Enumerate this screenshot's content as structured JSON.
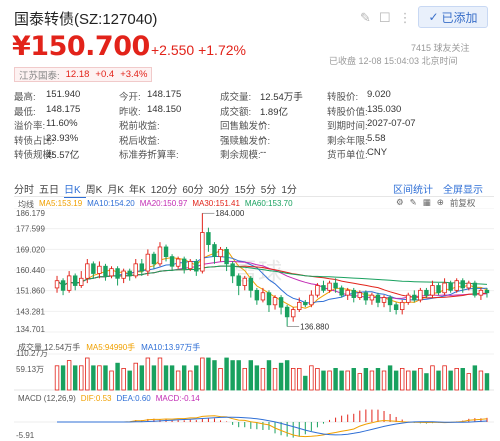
{
  "header": {
    "title": "国泰转债(SZ:127040)",
    "follow_label": "已添加",
    "price": "¥150.700",
    "change": "+2.550 +1.72%",
    "followers": "7415 球友关注",
    "status": "已收盘 12-08 15:04:03 北京时间"
  },
  "stock": {
    "name": "江苏国泰:",
    "price": "12.18",
    "change": "+0.4",
    "pct": "+3.4%"
  },
  "quotes": [
    [
      [
        "最高:",
        "151.940",
        "red"
      ],
      [
        "今开:",
        "148.175",
        "red"
      ],
      [
        "成交量:",
        "12.54万手",
        ""
      ],
      [
        "转股价:",
        "9.020",
        ""
      ]
    ],
    [
      [
        "最低:",
        "148.175",
        "red"
      ],
      [
        "昨收:",
        "148.150",
        ""
      ],
      [
        "成交额:",
        "1.89亿",
        ""
      ],
      [
        "转股价值:",
        "135.030",
        ""
      ]
    ],
    [
      [
        "溢价率:",
        "11.60%",
        ""
      ],
      [
        "税前收益:",
        "--",
        ""
      ],
      [
        "回售触发价:",
        "--",
        ""
      ],
      [
        "到期时间:",
        "2027-07-07",
        ""
      ]
    ],
    [
      [
        "转债占比:",
        "23.93%",
        ""
      ],
      [
        "税后收益:",
        "--",
        ""
      ],
      [
        "强赎触发价:",
        "--",
        ""
      ],
      [
        "剩余年限:",
        "5.58",
        ""
      ]
    ],
    [
      [
        "转债规模:",
        "45.57亿",
        ""
      ],
      [
        "标准券折算率:",
        "--",
        ""
      ],
      [
        "剩余规模:",
        "--",
        ""
      ],
      [
        "货币单位:",
        "CNY",
        ""
      ]
    ]
  ],
  "chart_tabs": [
    "分时",
    "五日",
    "日K",
    "周K",
    "月K",
    "年K",
    "120分",
    "60分",
    "30分",
    "15分",
    "5分",
    "1分"
  ],
  "active_tab": "日K",
  "chart_links": [
    "区间统计",
    "全屏显示"
  ],
  "ma_legend": {
    "label": "均线",
    "ma5": "MA5:153.19",
    "ma10": "MA10:154.20",
    "ma20": "MA20:150.97",
    "ma30": "MA30:151.41",
    "ma60": "MA60:153.70"
  },
  "adjust_label": "前复权",
  "y_axis": [
    "186.179",
    "177.599",
    "169.020",
    "160.440",
    "151.860",
    "143.281",
    "134.701"
  ],
  "annotations": {
    "high": "184.000",
    "low": "136.880"
  },
  "watermark": "雪球",
  "volume": {
    "label": "成交量 12.54万手",
    "ma5": "MA5:94990手",
    "ma10": "MA10:13.97万手",
    "y_axis": [
      "110.27万",
      "59.13万"
    ]
  },
  "macd": {
    "label": "MACD (12,26,9)",
    "dif": "DIF:0.53",
    "dea": "DEA:0.60",
    "macd": "MACD:-0.14",
    "y_axis": [
      "-5.91"
    ]
  },
  "colors": {
    "up": "#e2231a",
    "down": "#19a15f",
    "accent": "#2f6fd6"
  },
  "chart_data": {
    "type": "candlestick",
    "y_range": [
      134.701,
      186.179
    ],
    "candles": [
      [
        153,
        156,
        151,
        158
      ],
      [
        156,
        152,
        150,
        157
      ],
      [
        152,
        158,
        151,
        160
      ],
      [
        158,
        154,
        152,
        159
      ],
      [
        154,
        157,
        153,
        160
      ],
      [
        157,
        163,
        155,
        165
      ],
      [
        163,
        159,
        157,
        164
      ],
      [
        159,
        162,
        157,
        164
      ],
      [
        162,
        158,
        156,
        163
      ],
      [
        158,
        161,
        157,
        162
      ],
      [
        161,
        157,
        154,
        162
      ],
      [
        157,
        160,
        155,
        161
      ],
      [
        160,
        158,
        156,
        161
      ],
      [
        158,
        163,
        157,
        165
      ],
      [
        163,
        160,
        158,
        165
      ],
      [
        160,
        167,
        158,
        169
      ],
      [
        167,
        163,
        161,
        168
      ],
      [
        163,
        170,
        162,
        172
      ],
      [
        170,
        166,
        164,
        171
      ],
      [
        166,
        162,
        160,
        167
      ],
      [
        162,
        165,
        161,
        166
      ],
      [
        165,
        161,
        159,
        166
      ],
      [
        161,
        164,
        160,
        165
      ],
      [
        164,
        160,
        158,
        165
      ],
      [
        160,
        176,
        159,
        184
      ],
      [
        176,
        171,
        168,
        178
      ],
      [
        171,
        166,
        163,
        172
      ],
      [
        166,
        169,
        164,
        170
      ],
      [
        169,
        163,
        160,
        170
      ],
      [
        163,
        158,
        155,
        164
      ],
      [
        158,
        154,
        150,
        159
      ],
      [
        154,
        157,
        152,
        158
      ],
      [
        157,
        152,
        149,
        158
      ],
      [
        152,
        148,
        146,
        153
      ],
      [
        148,
        151,
        147,
        153
      ],
      [
        151,
        146,
        143,
        152
      ],
      [
        146,
        149,
        144,
        150
      ],
      [
        149,
        145,
        142,
        150
      ],
      [
        145,
        141,
        137,
        146
      ],
      [
        141,
        144,
        139,
        145
      ],
      [
        144,
        147,
        143,
        149
      ],
      [
        147,
        146,
        145,
        148
      ],
      [
        146,
        150,
        145,
        152
      ],
      [
        150,
        154,
        149,
        155
      ],
      [
        154,
        152,
        151,
        156
      ],
      [
        152,
        155,
        151,
        156
      ],
      [
        155,
        153,
        151,
        157
      ],
      [
        153,
        150,
        149,
        154
      ],
      [
        150,
        152,
        148,
        153
      ],
      [
        152,
        149,
        147,
        153
      ],
      [
        149,
        151,
        148,
        152
      ],
      [
        151,
        148,
        146,
        152
      ],
      [
        148,
        150,
        146,
        151
      ],
      [
        150,
        147,
        145,
        151
      ],
      [
        147,
        149,
        145,
        150
      ],
      [
        149,
        146,
        143,
        150
      ],
      [
        146,
        144,
        142,
        147
      ],
      [
        144,
        147,
        142,
        148
      ],
      [
        147,
        150,
        146,
        151
      ],
      [
        150,
        148,
        147,
        152
      ],
      [
        148,
        152,
        147,
        153
      ],
      [
        152,
        150,
        149,
        153
      ],
      [
        150,
        154,
        149,
        156
      ],
      [
        154,
        151,
        150,
        155
      ],
      [
        151,
        155,
        150,
        157
      ],
      [
        155,
        152,
        151,
        156
      ],
      [
        152,
        156,
        151,
        157
      ],
      [
        156,
        153,
        151,
        157
      ],
      [
        153,
        155,
        152,
        156
      ],
      [
        155,
        150,
        149,
        156
      ],
      [
        150,
        152,
        148,
        153
      ],
      [
        152,
        151,
        149,
        153
      ]
    ]
  }
}
